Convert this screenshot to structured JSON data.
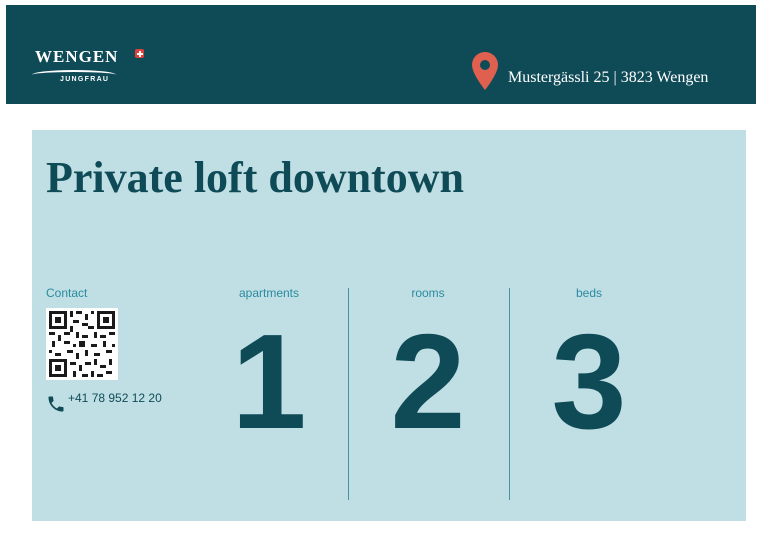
{
  "brand": {
    "name": "WENGEN",
    "sub": "JUNGFRAU"
  },
  "header": {
    "address": "Mustergässli 25 | 3823 Wengen",
    "location_icon": "map-pin-icon"
  },
  "listing": {
    "title": "Private loft downtown",
    "contact_label": "Contact",
    "phone": "+41 78 952 12 20",
    "stats": [
      {
        "label": "apartments",
        "value": "1"
      },
      {
        "label": "rooms",
        "value": "2"
      },
      {
        "label": "beds",
        "value": "3"
      }
    ]
  },
  "colors": {
    "header_bg": "#0f4b57",
    "card_bg": "#c0dfe4",
    "accent_pin": "#e0604f",
    "label_text": "#2a8ba0",
    "value_text": "#0f4b57"
  }
}
